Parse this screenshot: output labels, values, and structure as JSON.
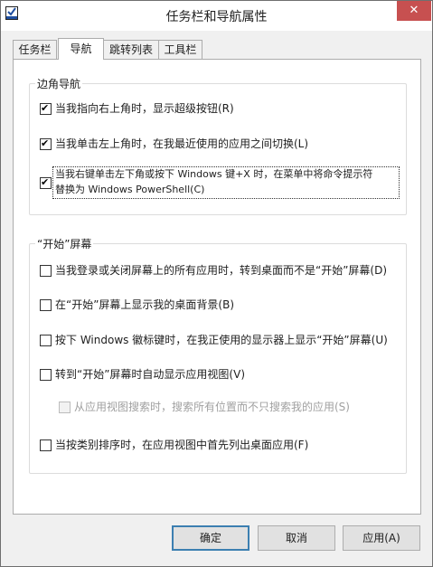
{
  "window": {
    "title": "任务栏和导航属性",
    "close_glyph": "✕"
  },
  "tabs": [
    {
      "label": "任务栏"
    },
    {
      "label": "导航"
    },
    {
      "label": "跳转列表"
    },
    {
      "label": "工具栏"
    }
  ],
  "corner_nav": {
    "label": "边角导航",
    "options": [
      {
        "text": "当我指向右上角时，显示超级按钮(R)",
        "checked": true
      },
      {
        "text": "当我单击左上角时，在我最近使用的应用之间切换(L)",
        "checked": true
      },
      {
        "text_line1": "当我右键单击左下角或按下 Windows 键+X 时，在菜单中将命令提示符",
        "text_line2": "替换为 Windows PowerShell(C)",
        "checked": true
      }
    ]
  },
  "start_screen": {
    "label": "“开始”屏幕",
    "options": [
      {
        "text": "当我登录或关闭屏幕上的所有应用时，转到桌面而不是“开始”屏幕(D)",
        "checked": false
      },
      {
        "text": "在“开始”屏幕上显示我的桌面背景(B)",
        "checked": false
      },
      {
        "text": "按下 Windows 徽标键时，在我正使用的显示器上显示“开始”屏幕(U)",
        "checked": false
      },
      {
        "text": "转到“开始”屏幕时自动显示应用视图(V)",
        "checked": false
      },
      {
        "text": "从应用视图搜索时，搜索所有位置而不只搜索我的应用(S)",
        "checked": false,
        "disabled": true
      },
      {
        "text": "当按类别排序时，在应用视图中首先列出桌面应用(F)",
        "checked": false
      }
    ]
  },
  "buttons": {
    "ok": "确定",
    "cancel": "取消",
    "apply": "应用(A)"
  }
}
